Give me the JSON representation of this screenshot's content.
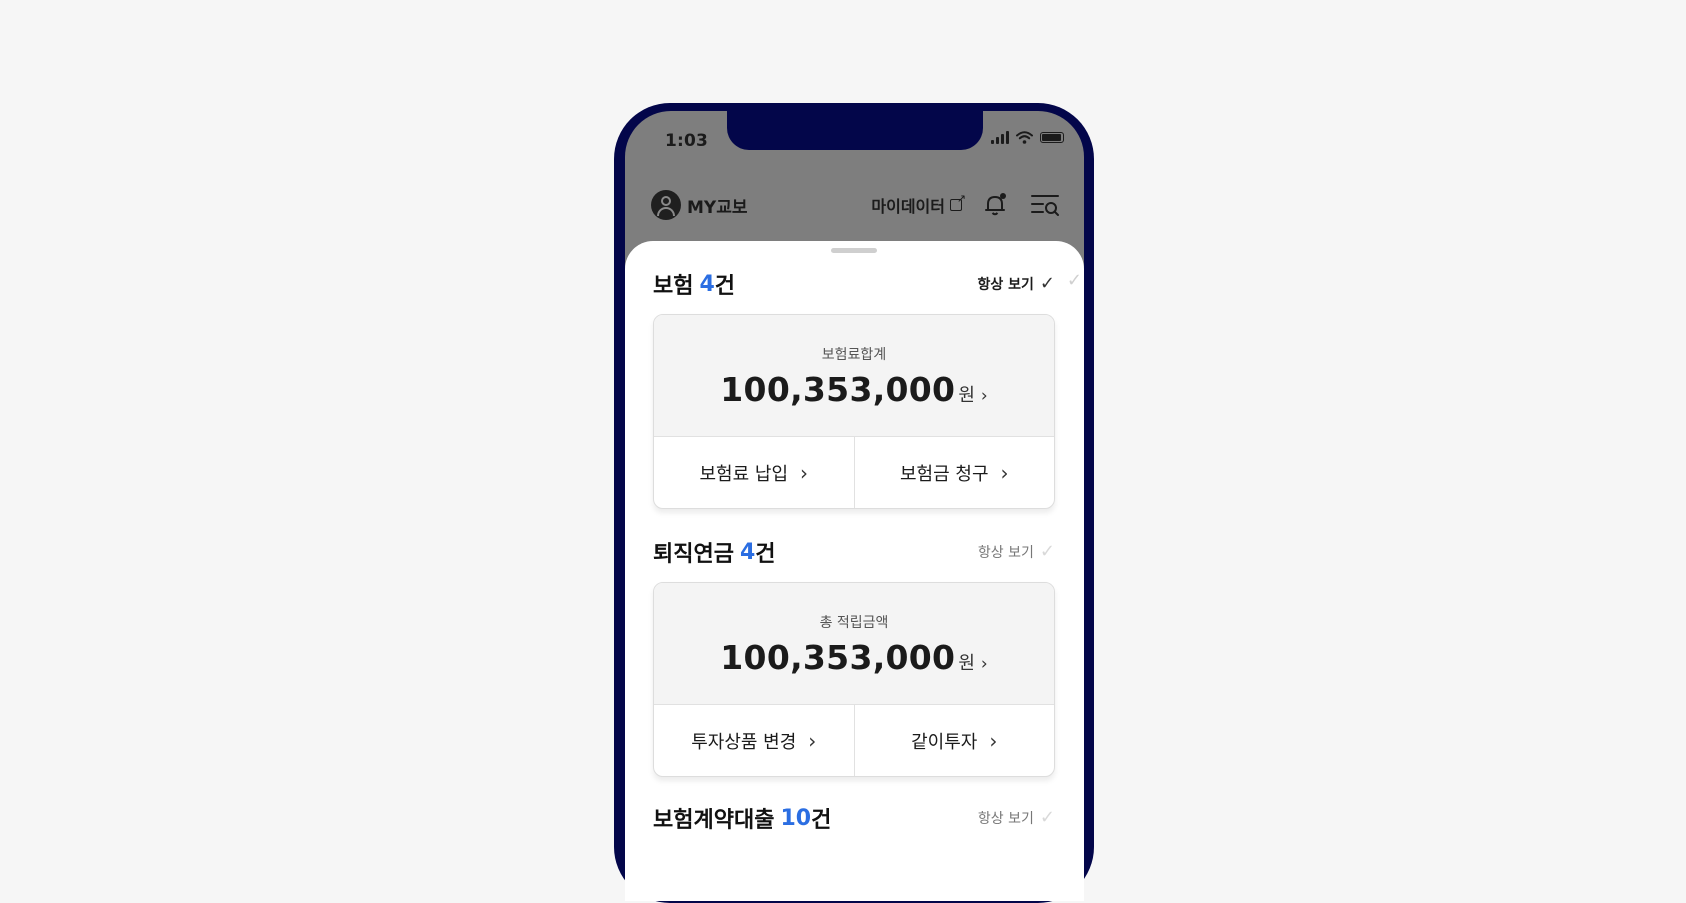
{
  "status": {
    "time": "1:03"
  },
  "header": {
    "my_label": "MY교보",
    "mydata_label": "마이데이터"
  },
  "sections": [
    {
      "title": "보험",
      "count": "4",
      "unit": "건",
      "always_label": "항상 보기",
      "always_checked": true,
      "card_label": "보험료합계",
      "amount": "100,353,000",
      "currency": "원",
      "actions": [
        "보험료 납입",
        "보험금 청구"
      ]
    },
    {
      "title": "퇴직연금",
      "count": "4",
      "unit": "건",
      "always_label": "항상 보기",
      "always_checked": false,
      "card_label": "총 적립금액",
      "amount": "100,353,000",
      "currency": "원",
      "actions": [
        "투자상품 변경",
        "같이투자"
      ]
    },
    {
      "title": "보험계약대출",
      "count": "10",
      "unit": "건",
      "always_label": "항상 보기",
      "always_checked": false
    }
  ],
  "colors": {
    "accent": "#2b6ee2",
    "phone_frame": "#03064a",
    "dim_overlay": "#7e7e7e",
    "background": "#f6f6f6"
  }
}
